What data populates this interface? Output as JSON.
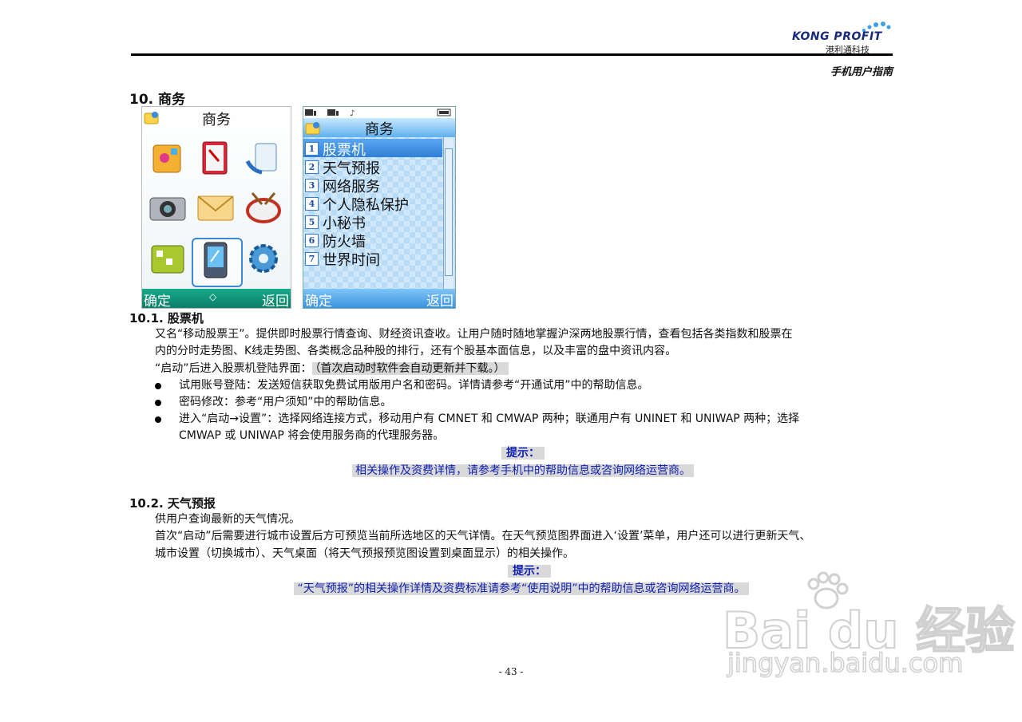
{
  "header": {
    "logo_brand": "KONG PROFIT",
    "logo_cn": "港利通科技",
    "guide_title": "手机用户指南"
  },
  "section": {
    "title": "10. 商务"
  },
  "phone1": {
    "title": "商务",
    "soft_left": "确定",
    "soft_right": "返回",
    "nav_glyph": "◇",
    "icons": [
      "game-cube-icon",
      "address-book-icon",
      "phone-call-icon",
      "camera-icon",
      "envelope-icon",
      "drum-icon",
      "toolbox-icon",
      "pda-icon",
      "gear-icon"
    ]
  },
  "phone2": {
    "title": "商务",
    "menu": [
      {
        "num": "1",
        "label": "股票机"
      },
      {
        "num": "2",
        "label": "天气预报"
      },
      {
        "num": "3",
        "label": "网络服务"
      },
      {
        "num": "4",
        "label": "个人隐私保护"
      },
      {
        "num": "5",
        "label": "小秘书"
      },
      {
        "num": "6",
        "label": "防火墙"
      },
      {
        "num": "7",
        "label": "世界时间"
      }
    ],
    "soft_left": "确定",
    "soft_right": "返回"
  },
  "stock": {
    "heading": "10.1. 股票机",
    "p1_line1": "又名“移动股票王”。提供即时股票行情查询、财经资讯查收。让用户随时随地掌握沪深两地股票行情，查看包括各类指数和股票在",
    "p1_line2": "内的分时走势图、K线走势图、各类概念品种股的排行，还有个股基本面信息，以及丰富的盘中资讯内容。",
    "p2_prefix": "“启动”后进入股票机登陆界面：",
    "p2_highlight": "（首次启动时软件会自动更新并下载。）",
    "bullets": [
      "试用账号登陆：发送短信获取免费试用版用户名和密码。详情请参考“开通试用”中的帮助信息。",
      "密码修改：参考“用户须知”中的帮助信息。"
    ],
    "bullet3_line1": "进入“启动→设置”：选择网络连接方式，移动用户有 CMNET 和 CMWAP 两种；联通用户有 UNINET 和 UNIWAP 两种；选择",
    "bullet3_line2": "CMWAP 或 UNIWAP 将会使用服务商的代理服务器。",
    "tip_label": "提示：",
    "tip_text": "相关操作及资费详情，请参考手机中的帮助信息或咨询网络运营商。"
  },
  "weather": {
    "heading": "10.2. 天气预报",
    "p1": "供用户查询最新的天气情况。",
    "p2_line1": "首次“启动”后需要进行城市设置后方可预览当前所选地区的天气详情。在天气预览图界面进入‘设置’菜单，用户还可以进行更新天气、",
    "p2_line2": "城市设置（切换城市）、天气桌面（将天气预报预览图设置到桌面显示）的相关操作。",
    "tip_label": "提示：",
    "tip_text": "“天气预报”的相关操作详情及资费标准请参考“使用说明”中的帮助信息或咨询网络运营商。"
  },
  "footer": {
    "page_number": "- 43 -"
  },
  "watermark": {
    "brand": "Bai du 经验",
    "url": "jingyan.baidu.com"
  }
}
